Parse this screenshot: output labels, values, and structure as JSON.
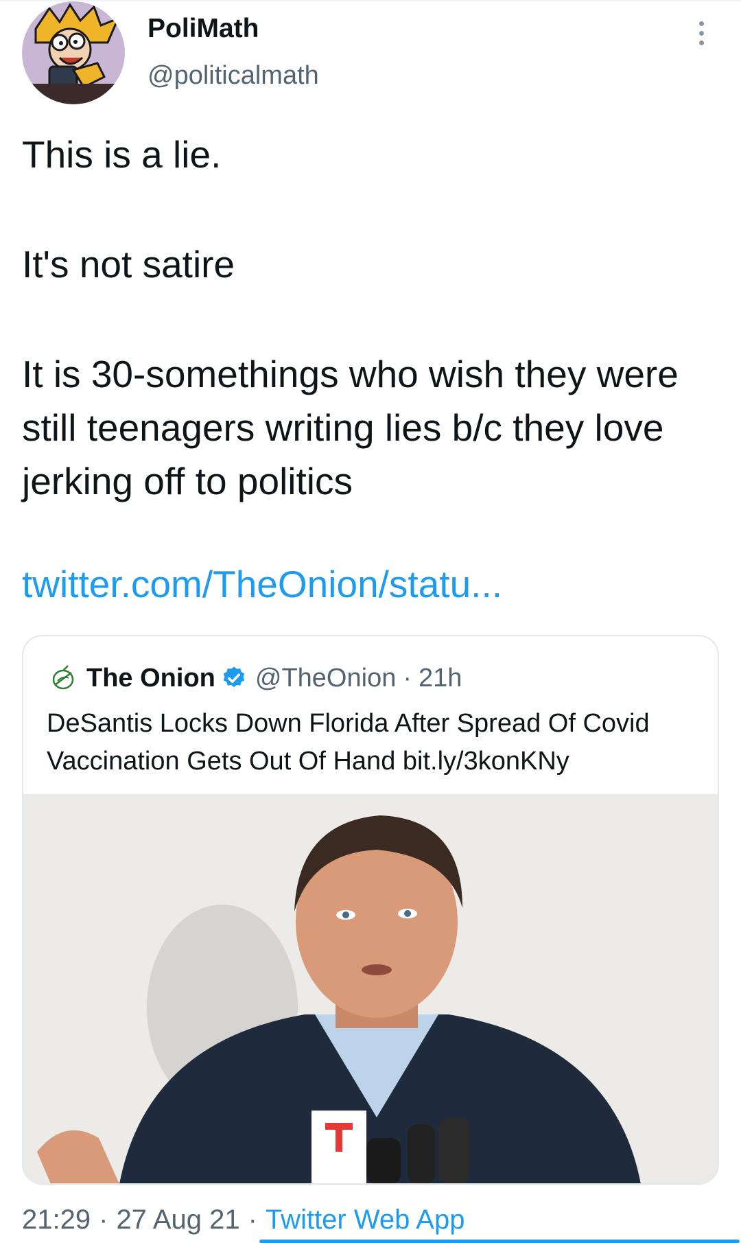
{
  "tweet": {
    "author": {
      "display_name": "PoliMath",
      "handle": "@politicalmath",
      "avatar_icon": "cartoon-avatar-icon"
    },
    "paragraphs": [
      "This is a lie.",
      "It's not satire",
      "It is 30-somethings who wish they were still teenagers writing lies b/c they love jerking off to politics"
    ],
    "link": "twitter.com/TheOnion/statu...",
    "quoted": {
      "author_name": "The Onion",
      "handle": "@TheOnion",
      "separator": "·",
      "time": "21h",
      "text": "DeSantis Locks Down Florida After Spread Of Covid Vaccination Gets Out Of Hand bit.ly/3konKNy",
      "verified": true,
      "media_icon": "press-photo-image"
    },
    "meta": {
      "time": "21:29",
      "separator": "·",
      "date": "27 Aug 21",
      "source": "Twitter Web App"
    }
  },
  "colors": {
    "accent": "#1d9bf0",
    "text": "#0f1419",
    "secondary": "#536471",
    "border": "#e3e8eb"
  }
}
